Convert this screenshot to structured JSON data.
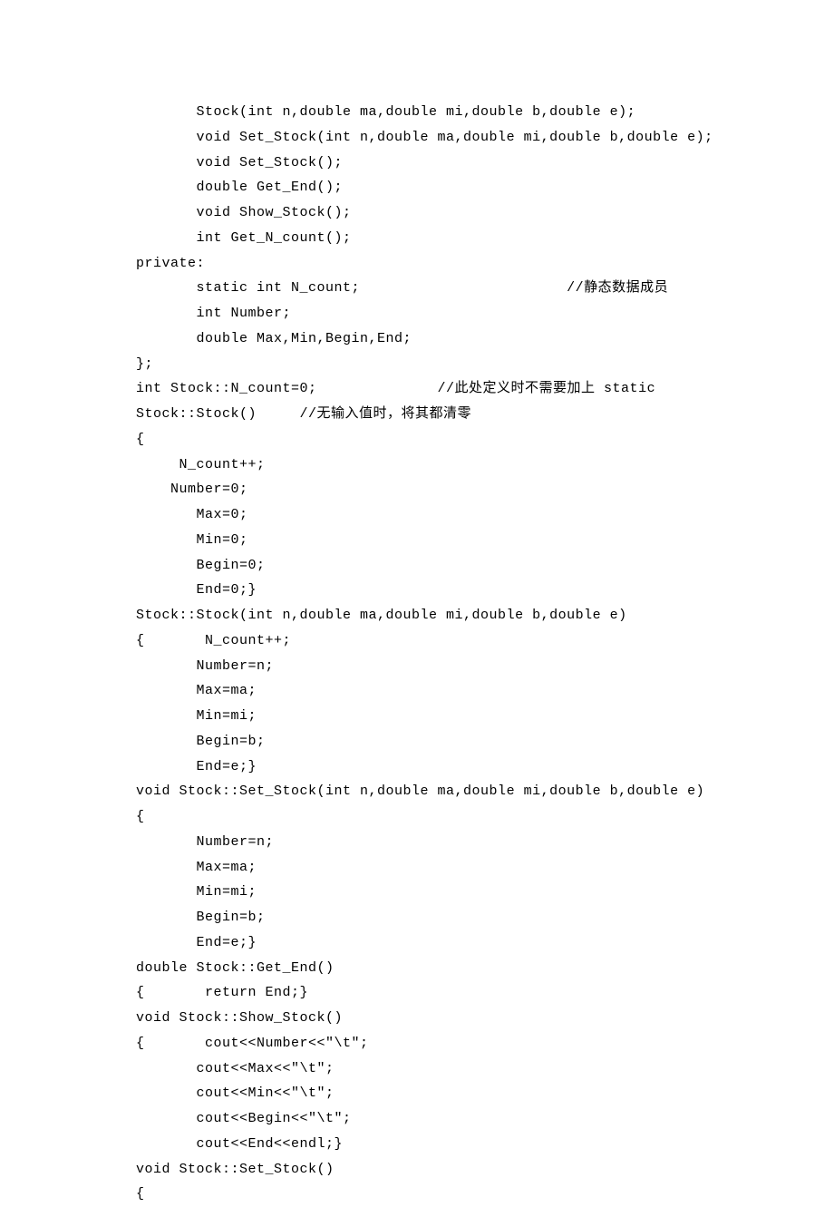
{
  "code_lines": [
    "       Stock(int n,double ma,double mi,double b,double e);",
    "       void Set_Stock(int n,double ma,double mi,double b,double e);",
    "       void Set_Stock();",
    "       double Get_End();",
    "       void Show_Stock();",
    "       int Get_N_count();",
    "private:",
    "       static int N_count;                        //静态数据成员",
    "       int Number;",
    "       double Max,Min,Begin,End;",
    "};",
    "int Stock::N_count=0;              //此处定义时不需要加上 static",
    "Stock::Stock()     //无输入值时，将其都清零",
    "{",
    "     N_count++;",
    "    Number=0;",
    "       Max=0;",
    "       Min=0;",
    "       Begin=0;",
    "       End=0;}",
    "Stock::Stock(int n,double ma,double mi,double b,double e)",
    "{       N_count++;",
    "       Number=n;",
    "       Max=ma;",
    "       Min=mi;",
    "       Begin=b;",
    "       End=e;}",
    "void Stock::Set_Stock(int n,double ma,double mi,double b,double e)",
    "{",
    "       Number=n;",
    "       Max=ma;",
    "       Min=mi;",
    "       Begin=b;",
    "       End=e;}",
    "double Stock::Get_End()",
    "{       return End;}",
    "void Stock::Show_Stock()",
    "{       cout<<Number<<\"\\t\";",
    "       cout<<Max<<\"\\t\";",
    "       cout<<Min<<\"\\t\";",
    "       cout<<Begin<<\"\\t\";",
    "       cout<<End<<endl;}",
    "void Stock::Set_Stock()",
    "{"
  ]
}
